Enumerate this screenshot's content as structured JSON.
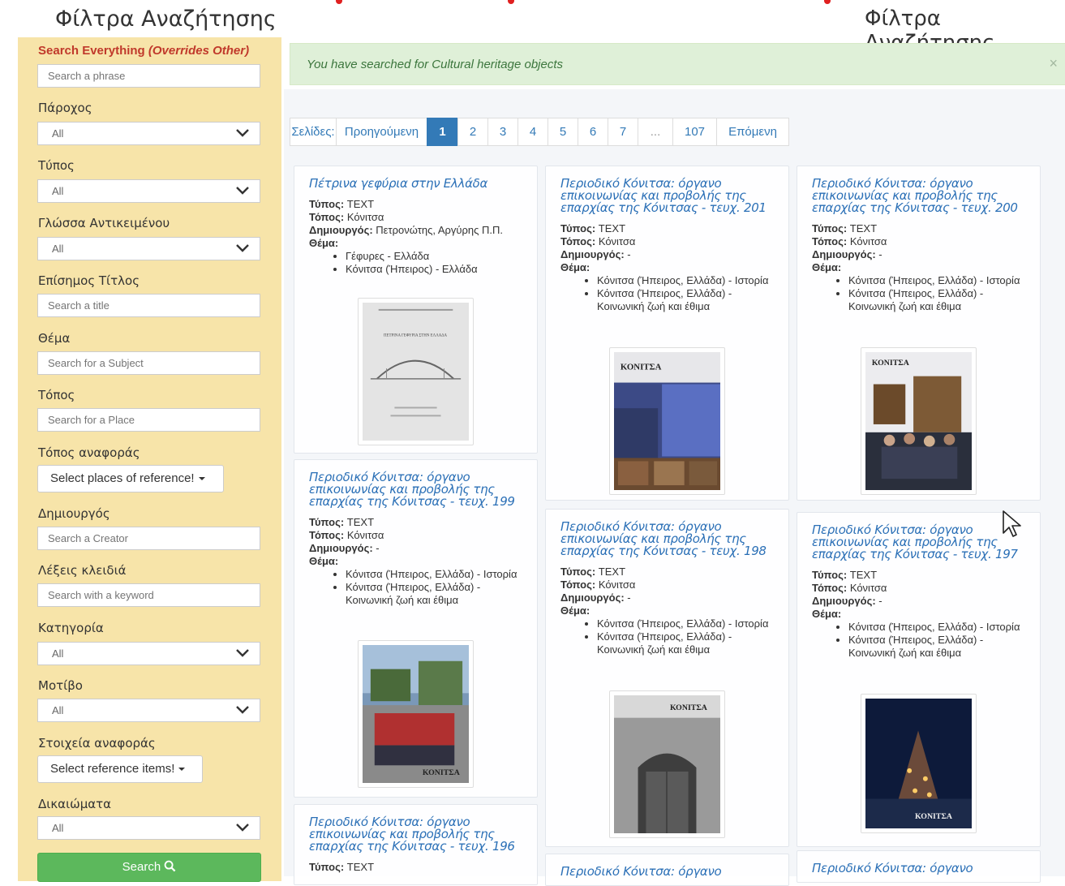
{
  "header": {
    "title_left": "Φίλτρα Αναζήτησης",
    "title_right": "Φίλτρα Αναζήτησης"
  },
  "sidebar": {
    "search_everything_label": "Search Everything",
    "search_everything_note": "(Overrides Other)",
    "search_everything_placeholder": "Search a phrase",
    "provider_label": "Πάροχος",
    "provider_value": "All",
    "type_label": "Τύπος",
    "type_value": "All",
    "language_label": "Γλώσσα Αντικειμένου",
    "language_value": "All",
    "title_label": "Επίσημος Τίτλος",
    "title_placeholder": "Search a title",
    "subject_label": "Θέμα",
    "subject_placeholder": "Search for a Subject",
    "place_label": "Τόπος",
    "place_placeholder": "Search for a Place",
    "ref_place_label": "Τόπος αναφοράς",
    "ref_place_button": "Select places of reference!",
    "creator_label": "Δημιουργός",
    "creator_placeholder": "Search a Creator",
    "keywords_label": "Λέξεις κλειδιά",
    "keywords_placeholder": "Search with a keyword",
    "category_label": "Κατηγορία",
    "category_value": "All",
    "motif_label": "Μοτίβο",
    "motif_value": "All",
    "ref_items_label": "Στοιχεία αναφοράς",
    "ref_items_button": "Select reference items!",
    "rights_label": "Δικαιώματα",
    "rights_value": "All",
    "search_button": "Search"
  },
  "alert": {
    "message": "You have searched for Cultural heritage objects",
    "close": "×"
  },
  "pagination": {
    "items": [
      "Σελίδες:",
      "Προηγούμενη",
      "1",
      "2",
      "3",
      "4",
      "5",
      "6",
      "7",
      "...",
      "107",
      "Επόμενη"
    ],
    "active": "1"
  },
  "labels": {
    "type": "Τύπος:",
    "place": "Τόπος:",
    "creator": "Δημιουργός:",
    "subject": "Θέμα:"
  },
  "results": [
    {
      "title": "Πέτρινα γεφύρια στην Ελλάδα",
      "type": "TEXT",
      "place": "Κόνιτσα",
      "creator": "Πετρονώτης, Αργύρης Π.Π.",
      "subjects": [
        "Γέφυρες - Ελλάδα",
        "Κόνιτσα (Ήπειρος) - Ελλάδα"
      ]
    },
    {
      "title": "Περιοδικό Κόνιτσα: όργανο επικοινωνίας και προβολής της επαρχίας της Κόνιτσας - τευχ. 201",
      "type": "TEXT",
      "place": "Κόνιτσα",
      "creator": "-",
      "subjects": [
        "Κόνιτσα (Ήπειρος, Ελλάδα) - Ιστορία",
        "Κόνιτσα (Ήπειρος, Ελλάδα) - Κοινωνική ζωή και έθιμα"
      ]
    },
    {
      "title": "Περιοδικό Κόνιτσα: όργανο επικοινωνίας και προβολής της επαρχίας της Κόνιτσας - τευχ. 200",
      "type": "TEXT",
      "place": "Κόνιτσα",
      "creator": "-",
      "subjects": [
        "Κόνιτσα (Ήπειρος, Ελλάδα) - Ιστορία",
        "Κόνιτσα (Ήπειρος, Ελλάδα) - Κοινωνική ζωή και έθιμα"
      ]
    },
    {
      "title": "Περιοδικό Κόνιτσα: όργανο επικοινωνίας και προβολής της επαρχίας της Κόνιτσας - τευχ. 199",
      "type": "TEXT",
      "place": "Κόνιτσα",
      "creator": "-",
      "subjects": [
        "Κόνιτσα (Ήπειρος, Ελλάδα) - Ιστορία",
        "Κόνιτσα (Ήπειρος, Ελλάδα) - Κοινωνική ζωή και έθιμα"
      ]
    },
    {
      "title": "Περιοδικό Κόνιτσα: όργανο επικοινωνίας και προβολής της επαρχίας της Κόνιτσας - τευχ. 198",
      "type": "TEXT",
      "place": "Κόνιτσα",
      "creator": "-",
      "subjects": [
        "Κόνιτσα (Ήπειρος, Ελλάδα) - Ιστορία",
        "Κόνιτσα (Ήπειρος, Ελλάδα) - Κοινωνική ζωή και έθιμα"
      ]
    },
    {
      "title": "Περιοδικό Κόνιτσα: όργανο επικοινωνίας και προβολής της επαρχίας της Κόνιτσας - τευχ. 197",
      "type": "TEXT",
      "place": "Κόνιτσα",
      "creator": "-",
      "subjects": [
        "Κόνιτσα (Ήπειρος, Ελλάδα) - Ιστορία",
        "Κόνιτσα (Ήπειρος, Ελλάδα) - Κοινωνική ζωή και έθιμα"
      ]
    },
    {
      "title": "Περιοδικό Κόνιτσα: όργανο επικοινωνίας και προβολής της επαρχίας της Κόνιτσας - τευχ. 196",
      "type": "TEXT"
    },
    {
      "title": "Περιοδικό Κόνιτσα: όργανο"
    },
    {
      "title": "Περιοδικό Κόνιτσα: όργανο"
    }
  ],
  "thumb_text": {
    "cover_title": "ΠΕΤΡΙΝΑ ΓΕΦΥΡΙΑ ΣΤΗΝ ΕΛΛΑΔΑ",
    "magazine_logo": "ΚΟΝΙΤΣΑ"
  }
}
